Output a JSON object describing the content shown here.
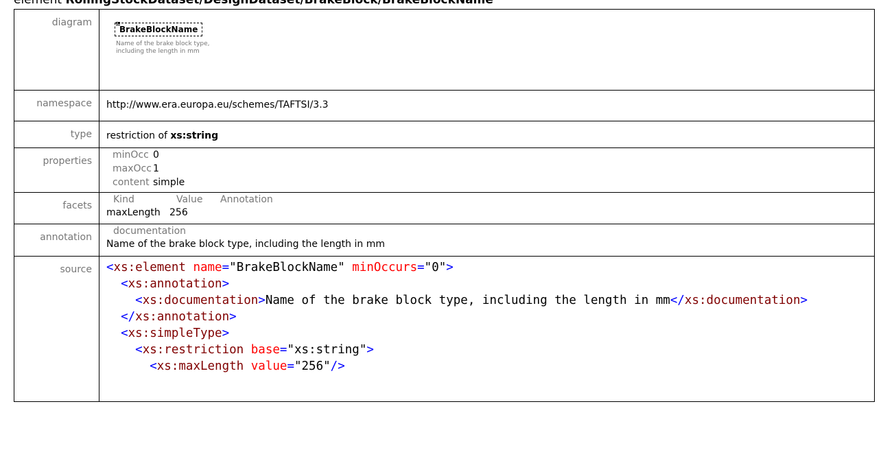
{
  "heading": {
    "prefix": "element",
    "path": "RollingStockDataset/DesignDataset/BrakeBlock/BrakeBlockName"
  },
  "labels": {
    "diagram": "diagram",
    "namespace": "namespace",
    "type": "type",
    "properties": "properties",
    "facets": "facets",
    "annotation": "annotation",
    "source": "source"
  },
  "diagram": {
    "element_name": "BrakeBlockName",
    "documentation": "Name of the brake block type, including the length in mm"
  },
  "namespace": "http://www.era.europa.eu/schemes/TAFTSI/3.3",
  "type": {
    "prefix": "restriction of",
    "base": "xs:string"
  },
  "properties": [
    {
      "key": "minOcc",
      "value": "0"
    },
    {
      "key": "maxOcc",
      "value": "1"
    },
    {
      "key": "content",
      "value": "simple"
    }
  ],
  "facets": {
    "headers": [
      "Kind",
      "Value",
      "Annotation"
    ],
    "rows": [
      {
        "kind": "maxLength",
        "value": "256",
        "annotation": ""
      }
    ]
  },
  "annotation": {
    "label": "documentation",
    "text": "Name of the brake block type, including the length in mm"
  },
  "source": {
    "lines": [
      [
        {
          "c": "t",
          "s": "<"
        },
        {
          "c": "tn",
          "s": "xs:element"
        },
        {
          "c": "av",
          "s": " "
        },
        {
          "c": "an",
          "s": "name"
        },
        {
          "c": "t",
          "s": "="
        },
        {
          "c": "av",
          "s": "\"BrakeBlockName\""
        },
        {
          "c": "av",
          "s": " "
        },
        {
          "c": "an",
          "s": "minOccurs"
        },
        {
          "c": "t",
          "s": "="
        },
        {
          "c": "av",
          "s": "\"0\""
        },
        {
          "c": "t",
          "s": ">"
        }
      ],
      [
        {
          "c": "av",
          "s": "  "
        },
        {
          "c": "t",
          "s": "<"
        },
        {
          "c": "tn",
          "s": "xs:annotation"
        },
        {
          "c": "t",
          "s": ">"
        }
      ],
      [
        {
          "c": "av",
          "s": "    "
        },
        {
          "c": "t",
          "s": "<"
        },
        {
          "c": "tn",
          "s": "xs:documentation"
        },
        {
          "c": "t",
          "s": ">"
        },
        {
          "c": "av",
          "s": "Name of the brake block type, including the length in mm"
        },
        {
          "c": "t",
          "s": "</"
        },
        {
          "c": "tn",
          "s": "xs:documentation"
        },
        {
          "c": "t",
          "s": ">"
        }
      ],
      [
        {
          "c": "av",
          "s": "  "
        },
        {
          "c": "t",
          "s": "</"
        },
        {
          "c": "tn",
          "s": "xs:annotation"
        },
        {
          "c": "t",
          "s": ">"
        }
      ],
      [
        {
          "c": "av",
          "s": "  "
        },
        {
          "c": "t",
          "s": "<"
        },
        {
          "c": "tn",
          "s": "xs:simpleType"
        },
        {
          "c": "t",
          "s": ">"
        }
      ],
      [
        {
          "c": "av",
          "s": "    "
        },
        {
          "c": "t",
          "s": "<"
        },
        {
          "c": "tn",
          "s": "xs:restriction"
        },
        {
          "c": "av",
          "s": " "
        },
        {
          "c": "an",
          "s": "base"
        },
        {
          "c": "t",
          "s": "="
        },
        {
          "c": "av",
          "s": "\"xs:string\""
        },
        {
          "c": "t",
          "s": ">"
        }
      ],
      [
        {
          "c": "av",
          "s": "      "
        },
        {
          "c": "t",
          "s": "<"
        },
        {
          "c": "tn",
          "s": "xs:maxLength"
        },
        {
          "c": "av",
          "s": " "
        },
        {
          "c": "an",
          "s": "value"
        },
        {
          "c": "t",
          "s": "="
        },
        {
          "c": "av",
          "s": "\"256\""
        },
        {
          "c": "t",
          "s": "/>"
        }
      ]
    ]
  },
  "colors": {
    "tag_bracket": "#0000ff",
    "tag_name": "#800000",
    "attr_name": "#ff0000",
    "label_gray": "#777777"
  },
  "icons": {
    "diagram_element": "element-doc-icon"
  }
}
